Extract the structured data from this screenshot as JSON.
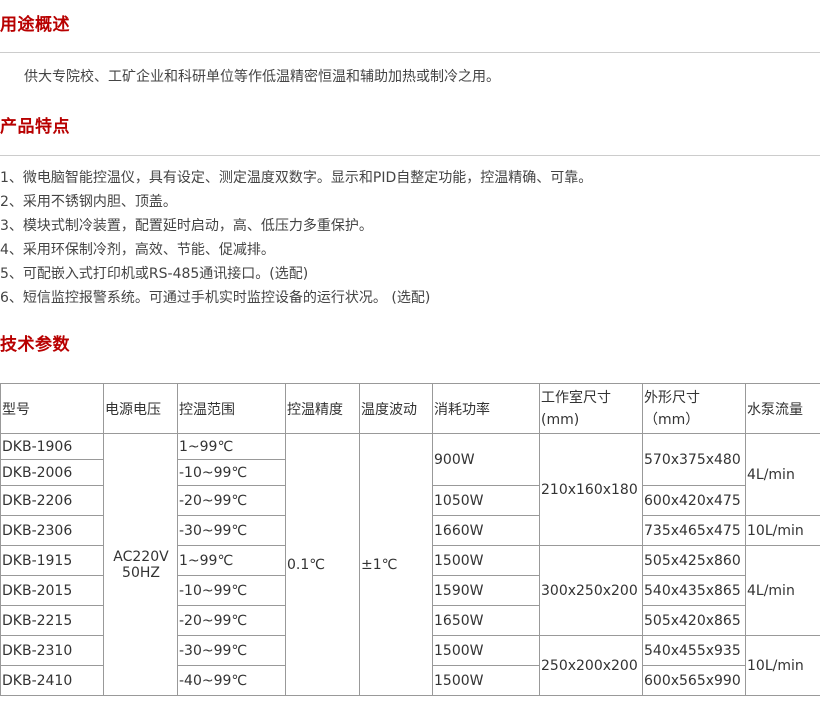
{
  "sections": {
    "usage": {
      "title": "用途概述",
      "text": "供大专院校、工矿企业和科研单位等作低温精密恒温和辅助加热或制冷之用。"
    },
    "features": {
      "title": "产品特点",
      "items": [
        "1、微电脑智能控温仪，具有设定、测定温度双数字。显示和PID自整定功能，控温精确、可靠。",
        "2、采用不锈钢内胆、顶盖。",
        "3、模块式制冷装置，配置延时启动，高、低压力多重保护。",
        "4、采用环保制冷剂，高效、节能、促减排。",
        "5、可配嵌入式打印机或RS-485通讯接口。(选配)",
        "6、短信监控报警系统。可通过手机实时监控设备的运行状况。 (选配)"
      ]
    },
    "specs": {
      "title": "技术参数"
    }
  },
  "table": {
    "headers": {
      "model": "型号",
      "power": "电源电压",
      "range": "控温范围",
      "precision": "控温精度",
      "fluctuation": "温度波动",
      "consumption": "消耗功率",
      "chamber": "工作室尺寸(mm)",
      "outer": "外形尺寸（mm）",
      "flow": "水泵流量"
    },
    "models": [
      "DKB-1906",
      "DKB-2006",
      "DKB-2206",
      "DKB-2306",
      "DKB-1915",
      "DKB-2015",
      "DKB-2215",
      "DKB-2310",
      "DKB-2410"
    ],
    "ranges": [
      "1~99℃",
      "-10~99℃",
      "-20~99℃",
      "-30~99℃",
      "1~99℃",
      "-10~99℃",
      "-20~99℃",
      "-30~99℃",
      "-40~99℃"
    ],
    "power_l1": "AC220V",
    "power_l2": "50HZ",
    "precision": "0.1℃",
    "fluctuation": "±1℃",
    "consumption": [
      "900W",
      "1050W",
      "1660W",
      "1500W",
      "1590W",
      "1650W",
      "1500W",
      "1500W"
    ],
    "chamber": [
      "210x160x180",
      "300x250x200",
      "250x200x200"
    ],
    "outer": [
      "570x375x480",
      "600x420x475",
      "735x465x475",
      "505x425x860",
      "540x435x865",
      "505x420x865",
      "540x455x935",
      "600x565x990"
    ],
    "flow": [
      "4L/min",
      "10L/min",
      "4L/min",
      "10L/min"
    ]
  }
}
